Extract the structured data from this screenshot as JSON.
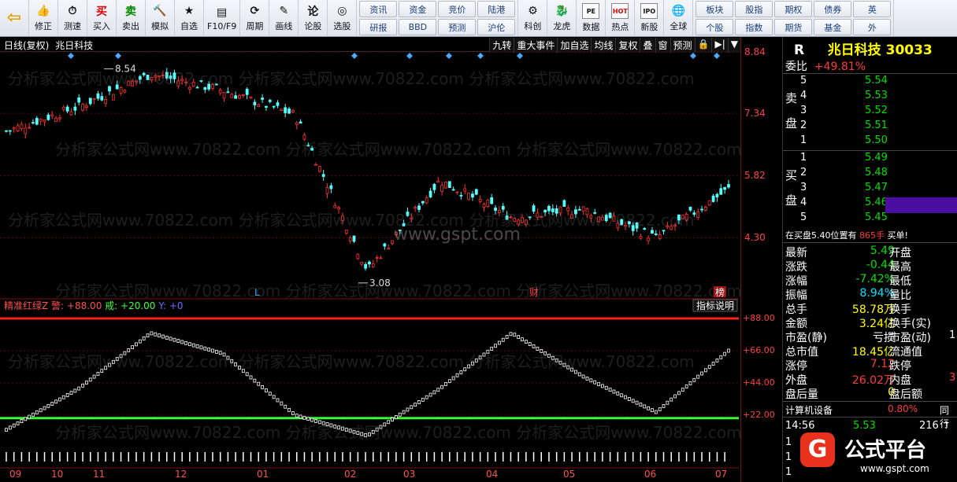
{
  "toolbar": {
    "buttons": [
      {
        "label": "",
        "icon": "back-arrow-icon"
      },
      {
        "label": "修正",
        "icon": "thumb-icon"
      },
      {
        "label": "测速",
        "icon": "clock-icon"
      },
      {
        "label": "买入",
        "icon": "buy-icon",
        "glyph": "买"
      },
      {
        "label": "卖出",
        "icon": "sell-icon",
        "glyph": "卖"
      },
      {
        "label": "模拟",
        "icon": "hammer-icon"
      },
      {
        "label": "自选",
        "icon": "star-folder-icon"
      },
      {
        "label": "F10/F9",
        "icon": "f10-icon"
      },
      {
        "label": "周期",
        "icon": "cycle-icon"
      },
      {
        "label": "画线",
        "icon": "pen-icon"
      },
      {
        "label": "论股",
        "icon": "forum-icon",
        "glyph": "论"
      },
      {
        "label": "选股",
        "icon": "select-stock-icon"
      }
    ],
    "grid1": [
      "资讯",
      "资金",
      "竞价",
      "陆港",
      "研报",
      "BBD",
      "预测",
      "沪伦"
    ],
    "buttons2": [
      {
        "label": "科创",
        "icon": "science-icon"
      },
      {
        "label": "龙虎",
        "icon": "dragon-icon"
      },
      {
        "label": "数据",
        "icon": "data-icon",
        "glyph": "PE"
      },
      {
        "label": "热点",
        "icon": "hot-icon",
        "glyph": "HOT"
      },
      {
        "label": "新股",
        "icon": "ipo-icon",
        "glyph": "IPO"
      },
      {
        "label": "全球",
        "icon": "globe-icon"
      }
    ],
    "grid2": [
      "板块",
      "股指",
      "期权",
      "债券",
      "英",
      "个股",
      "指数",
      "期货",
      "基金",
      "外"
    ]
  },
  "chart": {
    "mode_label": "日线(复权)",
    "stock_name": "兆日科技",
    "menu": [
      "九转",
      "重大事件",
      "加自选",
      "均线",
      "复权",
      "叠",
      "窗",
      "预测"
    ],
    "high_marker": "8.54",
    "low_marker": "3.08",
    "event_markers": [
      "L",
      "财",
      "榜"
    ],
    "axis_top": [
      "8.84",
      "7.34",
      "5.82",
      "4.30"
    ],
    "axis_bottom": [
      "+88.00",
      "+66.00",
      "+44.00",
      "+22.00"
    ],
    "months": [
      "09",
      "10",
      "11",
      "12",
      "01",
      "02",
      "03",
      "04",
      "05",
      "06",
      "07"
    ],
    "watermark_domain": "www.gspt.com"
  },
  "indicator": {
    "name": "精准红绿Z",
    "warn_label": "警",
    "warn_value": "+88.00",
    "sell_label": "戒",
    "sell_value": "+20.00",
    "y_label": "Y",
    "y_value": "+0",
    "help": "指标说明"
  },
  "chart_data": {
    "type": "line",
    "title": "兆日科技 日线(复权)",
    "x_months": [
      "09",
      "10",
      "11",
      "12",
      "01",
      "02",
      "03",
      "04",
      "05",
      "06",
      "07"
    ],
    "price": {
      "name": "close",
      "ylim": [
        3.0,
        8.84
      ],
      "x": [
        "09",
        "10",
        "11",
        "12",
        "01",
        "02",
        "03",
        "04",
        "05",
        "06",
        "07"
      ],
      "values": [
        6.9,
        7.5,
        8.3,
        7.9,
        7.3,
        3.5,
        5.7,
        4.8,
        5.0,
        4.3,
        5.49
      ]
    },
    "indicator": {
      "name": "精准红绿Z",
      "ylim": [
        0,
        88
      ],
      "x": [
        "09",
        "10",
        "11",
        "12",
        "01",
        "02",
        "03",
        "04",
        "05",
        "06",
        "07"
      ],
      "values": [
        12,
        40,
        78,
        64,
        22,
        8,
        40,
        78,
        48,
        24,
        66
      ],
      "lines": {
        "upper": 88,
        "lower": 20
      }
    }
  },
  "right_panel": {
    "code_prefix": "R",
    "name": "兆日科技",
    "code": "30033",
    "webi_label": "委比",
    "webi_value": "+49.81%",
    "sell_label_top": "卖",
    "sell_label_bottom": "盘",
    "buy_label_top": "买",
    "buy_label_bottom": "盘",
    "sell_levels": [
      {
        "lvl": "5",
        "price": "5.54"
      },
      {
        "lvl": "4",
        "price": "5.53"
      },
      {
        "lvl": "3",
        "price": "5.52"
      },
      {
        "lvl": "2",
        "price": "5.51"
      },
      {
        "lvl": "1",
        "price": "5.50"
      }
    ],
    "buy_levels": [
      {
        "lvl": "1",
        "price": "5.49"
      },
      {
        "lvl": "2",
        "price": "5.48"
      },
      {
        "lvl": "3",
        "price": "5.47"
      },
      {
        "lvl": "4",
        "price": "5.46"
      },
      {
        "lvl": "5",
        "price": "5.45"
      }
    ],
    "notice": "在买盘5.40位置有",
    "notice_value": "865手",
    "notice_tag": "买单!",
    "stats": [
      {
        "k": "最新",
        "v": "5.49",
        "k2": "开盘",
        "c": "green"
      },
      {
        "k": "涨跌",
        "v": "-0.44",
        "k2": "最高",
        "c": "green"
      },
      {
        "k": "涨幅",
        "v": "-7.42%",
        "k2": "最低",
        "c": "green"
      },
      {
        "k": "振幅",
        "v": "8.94%",
        "k2": "量比",
        "c": "cyan"
      },
      {
        "k": "总手",
        "v": "58.78万",
        "k2": "换手",
        "c": "yellow"
      },
      {
        "k": "金额",
        "v": "3.24亿",
        "k2": "换手(实)",
        "c": "yellow"
      },
      {
        "k": "市盈(静)",
        "v": "亏损",
        "k2": "市盈(动)",
        "c": "white"
      },
      {
        "k": "总市值",
        "v": "18.45亿",
        "k2": "流通值",
        "c": "yellow"
      },
      {
        "k": "涨停",
        "v": "7.12",
        "k2": "跌停",
        "c": "red"
      },
      {
        "k": "外盘",
        "v": "26.02万",
        "k2": "内盘",
        "c": "red"
      },
      {
        "k": "盘后量",
        "v": "0",
        "k2": "盘后额",
        "c": "yellow"
      }
    ],
    "stats_right": [
      "1",
      "3"
    ],
    "sector": "计算机设备",
    "sector_pct": "0.80%",
    "sector_tag": "同行",
    "tick_time": "14:56",
    "tick_price": "5.53",
    "tick_vol": "216",
    "tick_rows": [
      "1",
      "1",
      "1"
    ],
    "logo_text": "公式平台",
    "logo_url": "www.gspt.com"
  }
}
